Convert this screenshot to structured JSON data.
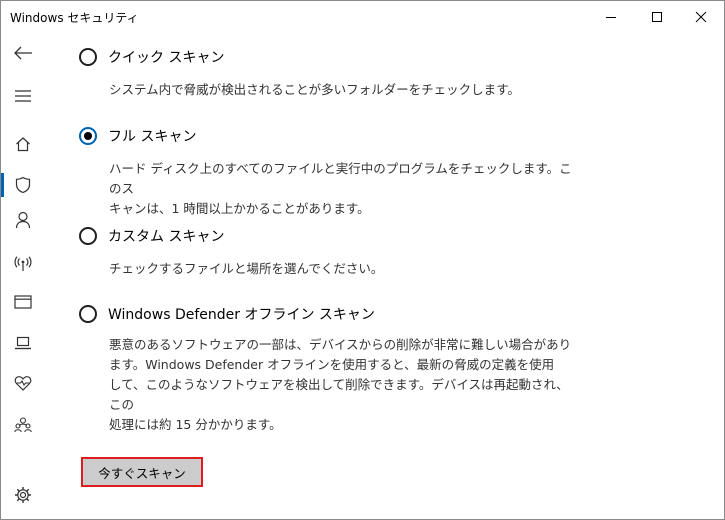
{
  "window": {
    "title": "Windows セキュリティ",
    "controls": [
      "minimize",
      "maximize",
      "close"
    ]
  },
  "sidebar": {
    "items": [
      {
        "icon": "back-arrow-icon"
      },
      {
        "icon": "hamburger-menu-icon"
      },
      {
        "icon": "home-icon"
      },
      {
        "icon": "shield-icon",
        "active": true
      },
      {
        "icon": "person-icon"
      },
      {
        "icon": "wireless-antenna-icon"
      },
      {
        "icon": "app-browser-icon"
      },
      {
        "icon": "laptop-icon"
      },
      {
        "icon": "heart-pulse-icon"
      },
      {
        "icon": "family-icon"
      },
      {
        "icon": "gear-icon"
      }
    ],
    "accent": "#0063b1"
  },
  "scan_options": [
    {
      "label": "クイック スキャン",
      "selected": false,
      "description": [
        "システム内で脅威が検出されることが多いフォルダーをチェックします。"
      ]
    },
    {
      "label": "フル スキャン",
      "selected": true,
      "description": [
        "ハード ディスク上のすべてのファイルと実行中のプログラムをチェックします。このス",
        "キャンは、1 時間以上かかることがあります。"
      ]
    },
    {
      "label": "カスタム スキャン",
      "selected": false,
      "description": [
        "チェックするファイルと場所を選んでください。"
      ]
    },
    {
      "label": "Windows Defender オフライン スキャン",
      "selected": false,
      "description": [
        "悪意のあるソフトウェアの一部は、デバイスからの削除が非常に難しい場合があり",
        "ます。Windows Defender オフラインを使用すると、最新の脅威の定義を使用",
        "して、このようなソフトウェアを検出して削除できます。デバイスは再起動され、この",
        "処理には約 15 分かかります。"
      ]
    }
  ],
  "scan_button": {
    "label": "今すぐスキャン",
    "highlight_color": "#e01d1d"
  }
}
